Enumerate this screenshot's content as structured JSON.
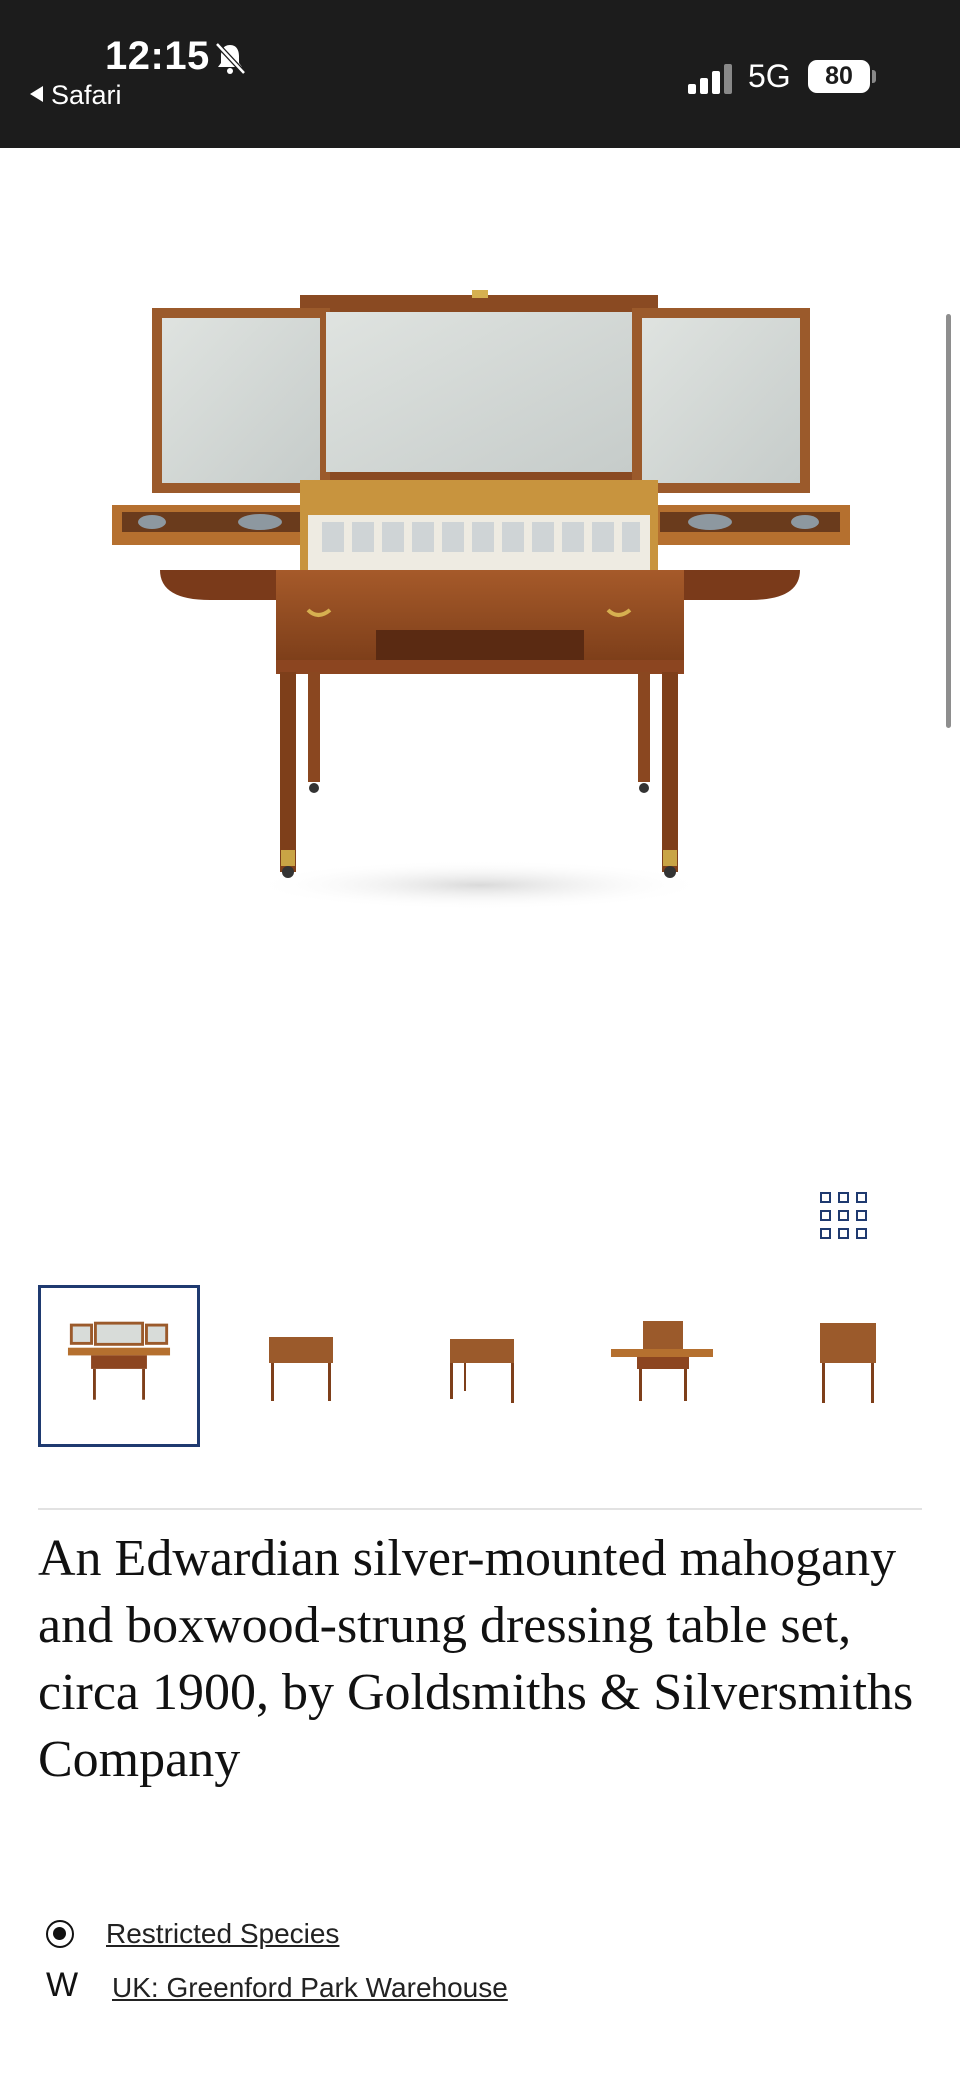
{
  "status_bar": {
    "time": "12:15",
    "back_app": "Safari",
    "network": "5G",
    "battery": "80"
  },
  "gallery": {
    "main_image_alt": "dressing-table-open",
    "thumbnails": [
      {
        "name": "thumbnail-open-mirrors",
        "selected": true
      },
      {
        "name": "thumbnail-front",
        "selected": false
      },
      {
        "name": "thumbnail-angle",
        "selected": false
      },
      {
        "name": "thumbnail-top-open",
        "selected": false
      },
      {
        "name": "thumbnail-side",
        "selected": false
      }
    ]
  },
  "lot": {
    "title": "An Edwardian silver-mounted mahogany and boxwood-strung dressing table set, circa 1900, by Goldsmiths & Silversmiths Company",
    "restricted_label": "Restricted Species",
    "warehouse_icon_letter": "W",
    "warehouse_label": "UK: Greenford Park Warehouse"
  },
  "colors": {
    "status_bg": "#1c1c1c",
    "accent": "#1f3a70",
    "wood": "#9a4f24"
  }
}
